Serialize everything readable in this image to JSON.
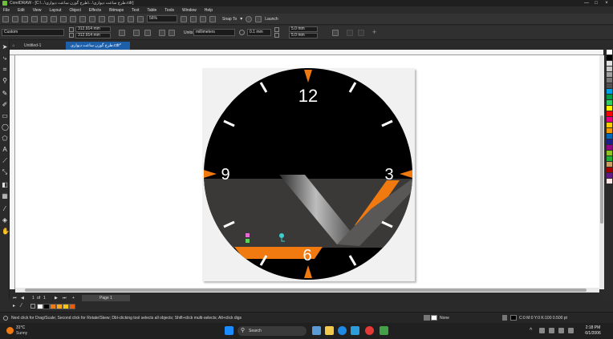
{
  "window": {
    "title": "CorelDRAW - [C:\\...\\طرح ساعت دیواری\\...\\طرح گوزن ساعت دیواری.cdr]",
    "controls": [
      "—",
      "□",
      "×"
    ]
  },
  "menu": [
    "File",
    "Edit",
    "View",
    "Layout",
    "Object",
    "Effects",
    "Bitmaps",
    "Text",
    "Table",
    "Tools",
    "Window",
    "Help"
  ],
  "toolbar": {
    "zoom": "56%",
    "snap_to": "Snap To",
    "launch": "Launch"
  },
  "property_bar": {
    "page_preset": "Custom",
    "width": "312.914 mm",
    "height": "312.914 mm",
    "units_label": "Units:",
    "units": "millimeters",
    "nudge": "0.1 mm",
    "dup_x": "5.0 mm",
    "dup_y": "5.0 mm"
  },
  "tabs": {
    "welcome": "Untitled-1",
    "active": "طرح گوزن ساعت دیواری.cdr*"
  },
  "clock": {
    "n12": "12",
    "n3": "3",
    "n6": "6",
    "n9": "9",
    "face_color": "#000000",
    "accent_color": "#f07a10",
    "band_color": "#3a3938"
  },
  "pagebar": {
    "page_counter": "1",
    "page_of": "of",
    "page_total": "1",
    "page_tab": "Page 1"
  },
  "colorbar": {
    "swatches": [
      "#ffffff",
      "#000000",
      "#f07a10",
      "#f7a81b",
      "#f5c518",
      "#e85d0c"
    ]
  },
  "palette": {
    "colors": [
      "#ffffff",
      "#000000",
      "#e0e0e0",
      "#c8c8c8",
      "#a0a0a0",
      "#787878",
      "#505050",
      "#00a0e9",
      "#009944",
      "#33cc66",
      "#fff100",
      "#ff0000",
      "#e4007f",
      "#ffcc00",
      "#f39800",
      "#0068b7",
      "#1d2088",
      "#920783",
      "#8fc31f",
      "#22ac38",
      "#c9a063",
      "#a40000",
      "#601986",
      "#ffe5e5"
    ]
  },
  "status": {
    "hint": "Next click for Drag/Scale; Second click for Rotate/Skew; Dbl-clicking tool selects all objects; Shift+click multi-selects; Alt+click digs",
    "fill": "None",
    "outline": "C:0 M:0 Y:0 K:100  0.500 pt"
  },
  "taskbar": {
    "weather_temp": "31°C",
    "weather_desc": "Sunny",
    "search": "Search",
    "time": "2:18 PM",
    "date": "6/1/2006"
  }
}
